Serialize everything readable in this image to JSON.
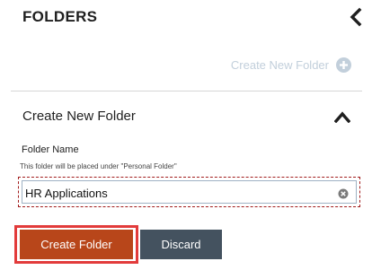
{
  "header": {
    "title": "FOLDERS",
    "collapse_icon": "chevron-left-icon"
  },
  "create_link": {
    "label": "Create New Folder",
    "icon": "plus-circle-icon"
  },
  "form": {
    "title": "Create New Folder",
    "toggle_icon": "chevron-up-icon",
    "field_label": "Folder Name",
    "hint": "This folder will be placed under \"Personal Folder\"",
    "input_value": "HR Applications",
    "clear_icon": "clear-circle-icon",
    "create_button": "Create Folder",
    "discard_button": "Discard"
  },
  "colors": {
    "create_button": "#b8461a",
    "discard_button": "#44525f",
    "link_muted": "#c2cfdb",
    "highlight": "#e23b3b"
  }
}
